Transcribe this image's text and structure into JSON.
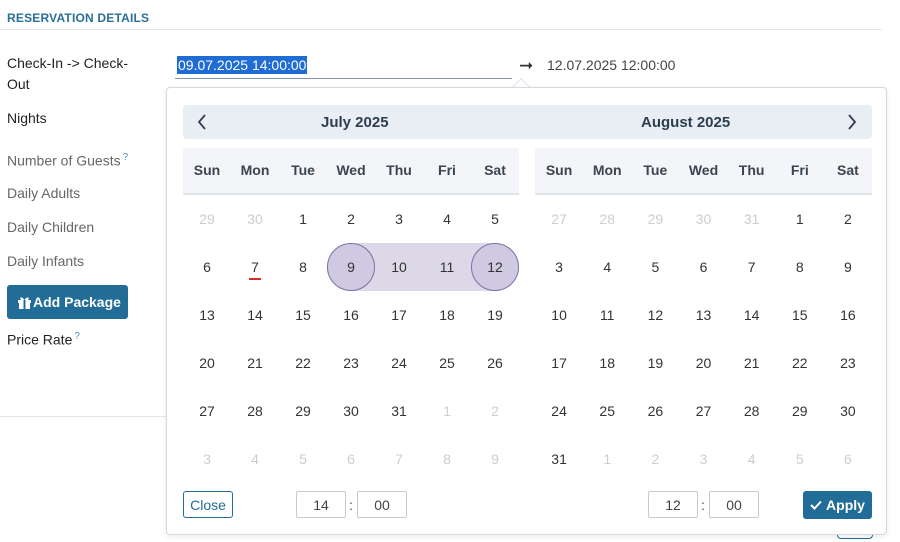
{
  "section": {
    "title": "RESERVATION DETAILS"
  },
  "labels": {
    "checkin_checkout_line1": "Check-In -> Check-",
    "checkin_checkout_line2": "Out",
    "nights": "Nights",
    "number_of_guests": "Number of Guests",
    "daily_adults": "Daily Adults",
    "daily_children": "Daily Children",
    "daily_infants": "Daily Infants",
    "price_rate": "Price Rate",
    "help_mark": "?"
  },
  "checkin": {
    "value": "09.07.2025 14:00:00"
  },
  "checkout": {
    "value": "12.07.2025 12:00:00"
  },
  "buttons": {
    "add_package": "Add Package",
    "close": "Close",
    "apply": "Apply"
  },
  "weekdays": [
    "Sun",
    "Mon",
    "Tue",
    "Wed",
    "Thu",
    "Fri",
    "Sat"
  ],
  "calendars": [
    {
      "title": "July 2025",
      "weeks": [
        [
          {
            "d": "29",
            "m": true
          },
          {
            "d": "30",
            "m": true
          },
          {
            "d": "1"
          },
          {
            "d": "2"
          },
          {
            "d": "3"
          },
          {
            "d": "4"
          },
          {
            "d": "5"
          }
        ],
        [
          {
            "d": "6"
          },
          {
            "d": "7",
            "today": true
          },
          {
            "d": "8"
          },
          {
            "d": "9",
            "start": true
          },
          {
            "d": "10",
            "inrange": true
          },
          {
            "d": "11",
            "inrange": true
          },
          {
            "d": "12",
            "end": true
          }
        ],
        [
          {
            "d": "13"
          },
          {
            "d": "14"
          },
          {
            "d": "15"
          },
          {
            "d": "16"
          },
          {
            "d": "17"
          },
          {
            "d": "18"
          },
          {
            "d": "19"
          }
        ],
        [
          {
            "d": "20"
          },
          {
            "d": "21"
          },
          {
            "d": "22"
          },
          {
            "d": "23"
          },
          {
            "d": "24"
          },
          {
            "d": "25"
          },
          {
            "d": "26"
          }
        ],
        [
          {
            "d": "27"
          },
          {
            "d": "28"
          },
          {
            "d": "29"
          },
          {
            "d": "30"
          },
          {
            "d": "31"
          },
          {
            "d": "1",
            "m": true
          },
          {
            "d": "2",
            "m": true
          }
        ],
        [
          {
            "d": "3",
            "m": true
          },
          {
            "d": "4",
            "m": true
          },
          {
            "d": "5",
            "m": true
          },
          {
            "d": "6",
            "m": true
          },
          {
            "d": "7",
            "m": true
          },
          {
            "d": "8",
            "m": true
          },
          {
            "d": "9",
            "m": true
          }
        ]
      ],
      "time": {
        "hour": "14",
        "minute": "00"
      }
    },
    {
      "title": "August 2025",
      "weeks": [
        [
          {
            "d": "27",
            "m": true
          },
          {
            "d": "28",
            "m": true
          },
          {
            "d": "29",
            "m": true
          },
          {
            "d": "30",
            "m": true
          },
          {
            "d": "31",
            "m": true
          },
          {
            "d": "1"
          },
          {
            "d": "2"
          }
        ],
        [
          {
            "d": "3"
          },
          {
            "d": "4"
          },
          {
            "d": "5"
          },
          {
            "d": "6"
          },
          {
            "d": "7"
          },
          {
            "d": "8"
          },
          {
            "d": "9"
          }
        ],
        [
          {
            "d": "10"
          },
          {
            "d": "11"
          },
          {
            "d": "12"
          },
          {
            "d": "13"
          },
          {
            "d": "14"
          },
          {
            "d": "15"
          },
          {
            "d": "16"
          }
        ],
        [
          {
            "d": "17"
          },
          {
            "d": "18"
          },
          {
            "d": "19"
          },
          {
            "d": "20"
          },
          {
            "d": "21"
          },
          {
            "d": "22"
          },
          {
            "d": "23"
          }
        ],
        [
          {
            "d": "24"
          },
          {
            "d": "25"
          },
          {
            "d": "26"
          },
          {
            "d": "27"
          },
          {
            "d": "28"
          },
          {
            "d": "29"
          },
          {
            "d": "30"
          }
        ],
        [
          {
            "d": "31"
          },
          {
            "d": "1",
            "m": true
          },
          {
            "d": "2",
            "m": true
          },
          {
            "d": "3",
            "m": true
          },
          {
            "d": "4",
            "m": true
          },
          {
            "d": "5",
            "m": true
          },
          {
            "d": "6",
            "m": true
          }
        ]
      ],
      "time": {
        "hour": "12",
        "minute": "00"
      }
    }
  ],
  "time_separator": ":",
  "icons": {
    "prev": "chevron-left-icon",
    "next": "chevron-right-icon",
    "arrow": "arrow-right-icon",
    "gift": "gift-icon",
    "check": "check-icon"
  },
  "colors": {
    "accent": "#226d97",
    "range": "#dcd8e7",
    "selected": "#cfc9e1",
    "today_marker": "#d62b2b",
    "selection_highlight": "#1f6cd4"
  }
}
